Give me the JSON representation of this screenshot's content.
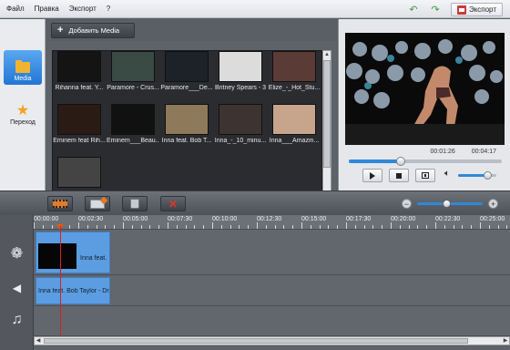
{
  "menu": {
    "file": "Файл",
    "edit": "Правка",
    "export": "Экспорт",
    "help": "?",
    "export_button": "Экспорт"
  },
  "sidebar": {
    "media": "Media",
    "transition": "Переход"
  },
  "library": {
    "add_media": "Добавить Media",
    "items": [
      {
        "label": "Rihanna feat. Y...",
        "color": "#141414"
      },
      {
        "label": "Paramore - Crus...",
        "color": "#3a4a44"
      },
      {
        "label": "Paramore___De...",
        "color": "#1c2228"
      },
      {
        "label": "Britney Spears - 3",
        "color": "#dcdcdc"
      },
      {
        "label": "Elize_-_Hot_Stu...",
        "color": "#5b3b36"
      },
      {
        "label": "Eminem feat Rih...",
        "color": "#2a1c14"
      },
      {
        "label": "Eminem___Beau...",
        "color": "#111111"
      },
      {
        "label": "Inna feat. Bob T...",
        "color": "#8e7a5a"
      },
      {
        "label": "Inna_-_10_minu...",
        "color": "#3d3432"
      },
      {
        "label": "Inna___Amazin...",
        "color": "#c7a58c"
      },
      {
        "label": "",
        "color": "#444444"
      }
    ]
  },
  "preview": {
    "current_time": "00:01:26",
    "total_time": "00:04:17",
    "progress": 0.34,
    "volume": 0.75
  },
  "timeline": {
    "ticks": [
      "00:00:00",
      "00:02:30",
      "00:05:00",
      "00:07:30",
      "00:10:00",
      "00:12:30",
      "00:15:00",
      "00:17:30",
      "00:20:00",
      "00:22:30",
      "00:25:00"
    ],
    "video_clip_label": "Inna feat.",
    "audio_clip_label": "Inna feat. Bob Taylor - Dr",
    "zoom_level": 0.44
  }
}
